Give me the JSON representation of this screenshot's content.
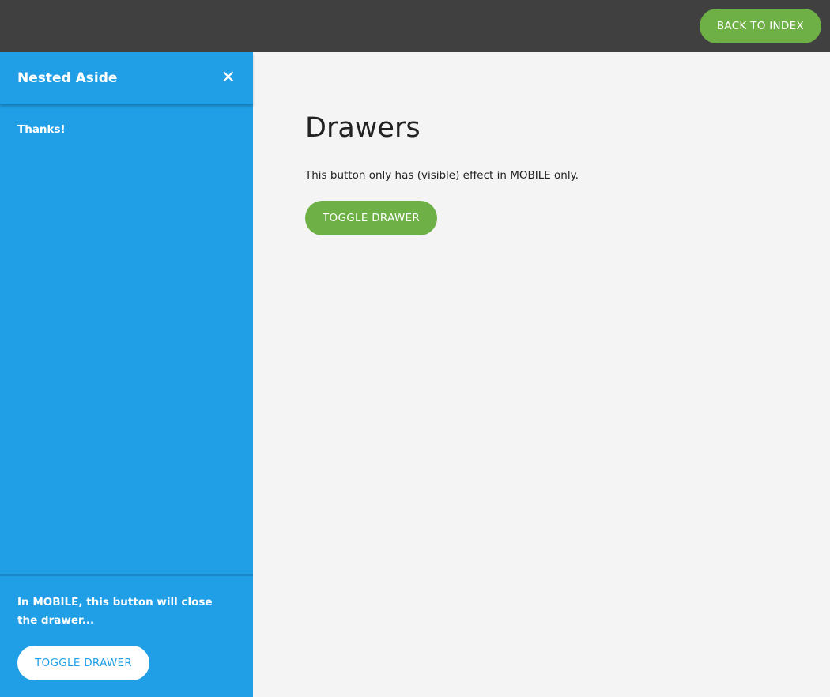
{
  "header": {
    "back_label": "BACK TO INDEX"
  },
  "aside": {
    "title": "Nested Aside",
    "close_icon": "close-icon",
    "body": "Thanks!",
    "footer_text": "In MOBILE, this button will close the drawer...",
    "toggle_label": "TOGGLE DRAWER"
  },
  "main": {
    "title": "Drawers",
    "description": "This button only has (visible) effect in MOBILE only.",
    "toggle_label": "TOGGLE DRAWER"
  },
  "colors": {
    "topbar": "#404040",
    "aside": "#209fe6",
    "green": "#6eb045",
    "background": "#f4f4f4"
  }
}
